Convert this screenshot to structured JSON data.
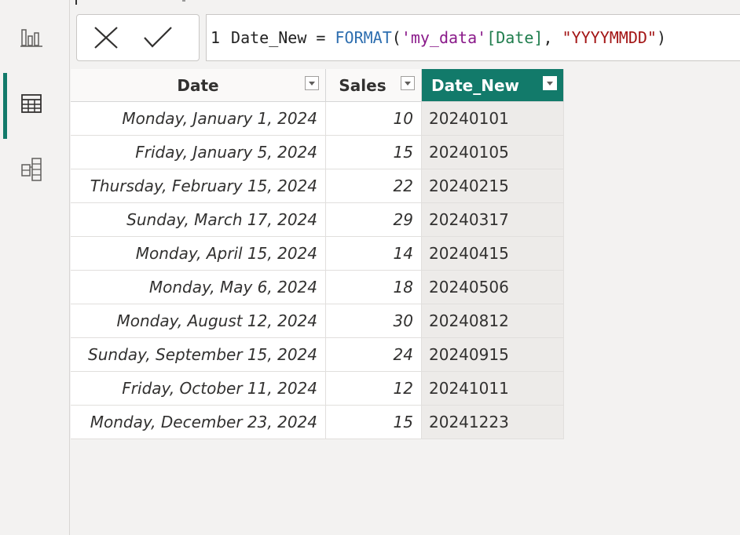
{
  "rail": {
    "items": [
      {
        "name": "report-view",
        "icon": "bar-chart-icon"
      },
      {
        "name": "table-view",
        "icon": "table-icon",
        "active": true
      },
      {
        "name": "model-view",
        "icon": "model-icon"
      }
    ],
    "accent": "#127a6a"
  },
  "formula_bar": {
    "cancel_icon": "close-icon",
    "commit_icon": "check-icon",
    "line_number": "1",
    "measure_name": "Date_New",
    "operator": "=",
    "function": "FORMAT",
    "open_paren": "(",
    "table_ref": "'my_data'",
    "column_ref": "[Date]",
    "separator": ",",
    "format_string": "\"YYYYMMDD\"",
    "close_paren": ")"
  },
  "table": {
    "columns": [
      {
        "label": "Date"
      },
      {
        "label": "Sales"
      },
      {
        "label": "Date_New",
        "selected": true
      }
    ],
    "rows": [
      {
        "date": "Monday, January 1, 2024",
        "sales": "10",
        "date_new": "20240101"
      },
      {
        "date": "Friday, January 5, 2024",
        "sales": "15",
        "date_new": "20240105"
      },
      {
        "date": "Thursday, February 15, 2024",
        "sales": "22",
        "date_new": "20240215"
      },
      {
        "date": "Sunday, March 17, 2024",
        "sales": "29",
        "date_new": "20240317"
      },
      {
        "date": "Monday, April 15, 2024",
        "sales": "14",
        "date_new": "20240415"
      },
      {
        "date": "Monday, May 6, 2024",
        "sales": "18",
        "date_new": "20240506"
      },
      {
        "date": "Monday, August 12, 2024",
        "sales": "30",
        "date_new": "20240812"
      },
      {
        "date": "Sunday, September 15, 2024",
        "sales": "24",
        "date_new": "20240915"
      },
      {
        "date": "Friday, October 11, 2024",
        "sales": "12",
        "date_new": "20241011"
      },
      {
        "date": "Monday, December 23, 2024",
        "sales": "15",
        "date_new": "20241223"
      }
    ]
  }
}
